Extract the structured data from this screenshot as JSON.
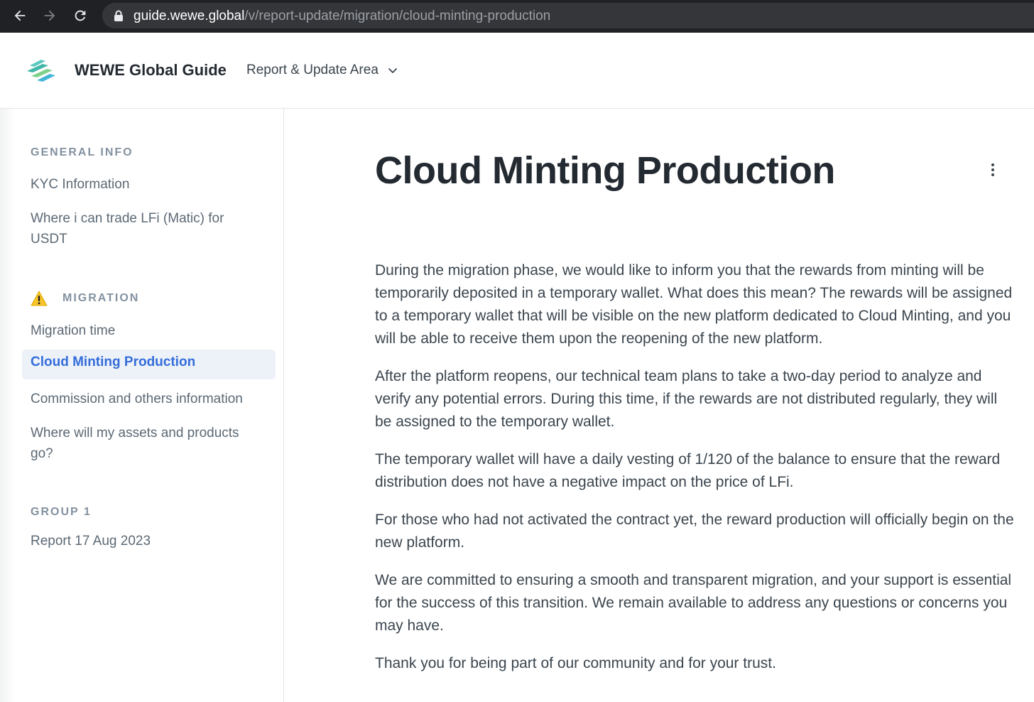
{
  "browser": {
    "url_host": "guide.wewe.global",
    "url_path": "/v/report-update/migration/cloud-minting-production"
  },
  "header": {
    "site_title": "WEWE Global Guide",
    "space_selector": "Report & Update Area"
  },
  "sidebar": {
    "sections": [
      {
        "label": "GENERAL INFO",
        "items": [
          "KYC Information",
          "Where i can trade LFi (Matic) for USDT"
        ]
      },
      {
        "label": "MIGRATION",
        "emoji_icon": "warning-icon",
        "items": [
          "Migration time",
          "Cloud Minting Production",
          "Commission and others information",
          "Where will my assets and products go?"
        ],
        "active": "Cloud Minting Production"
      },
      {
        "label": "GROUP 1",
        "items": [
          "Report 17 Aug 2023"
        ]
      }
    ]
  },
  "page": {
    "title": "Cloud Minting Production",
    "paragraphs": [
      "During the migration phase, we would like to inform you that the rewards from minting will be temporarily deposited in a temporary wallet. What does this mean? The rewards will be assigned to a temporary wallet that will be visible on the new platform dedicated to Cloud Minting, and you will be able to receive them upon the reopening of the new platform.",
      "After the platform reopens, our technical team plans to take a two-day period to analyze and verify any potential errors. During this time, if the rewards are not distributed regularly, they will be assigned to the temporary wallet.",
      "The temporary wallet will have a daily vesting of 1/120 of the balance to ensure that the reward distribution does not have a negative impact on the price of LFi.",
      "For those who had not activated the contract yet, the reward production will officially begin on the new platform.",
      "We are committed to ensuring a smooth and transparent migration, and your support is essential for the success of this transition. We remain available to address any questions or concerns you may have.",
      "Thank you for being part of our community and for your trust."
    ]
  },
  "colors": {
    "accent": "#346ddb",
    "active_bg": "#edf2f8",
    "text": "#3b454e",
    "heading": "#242a31"
  }
}
